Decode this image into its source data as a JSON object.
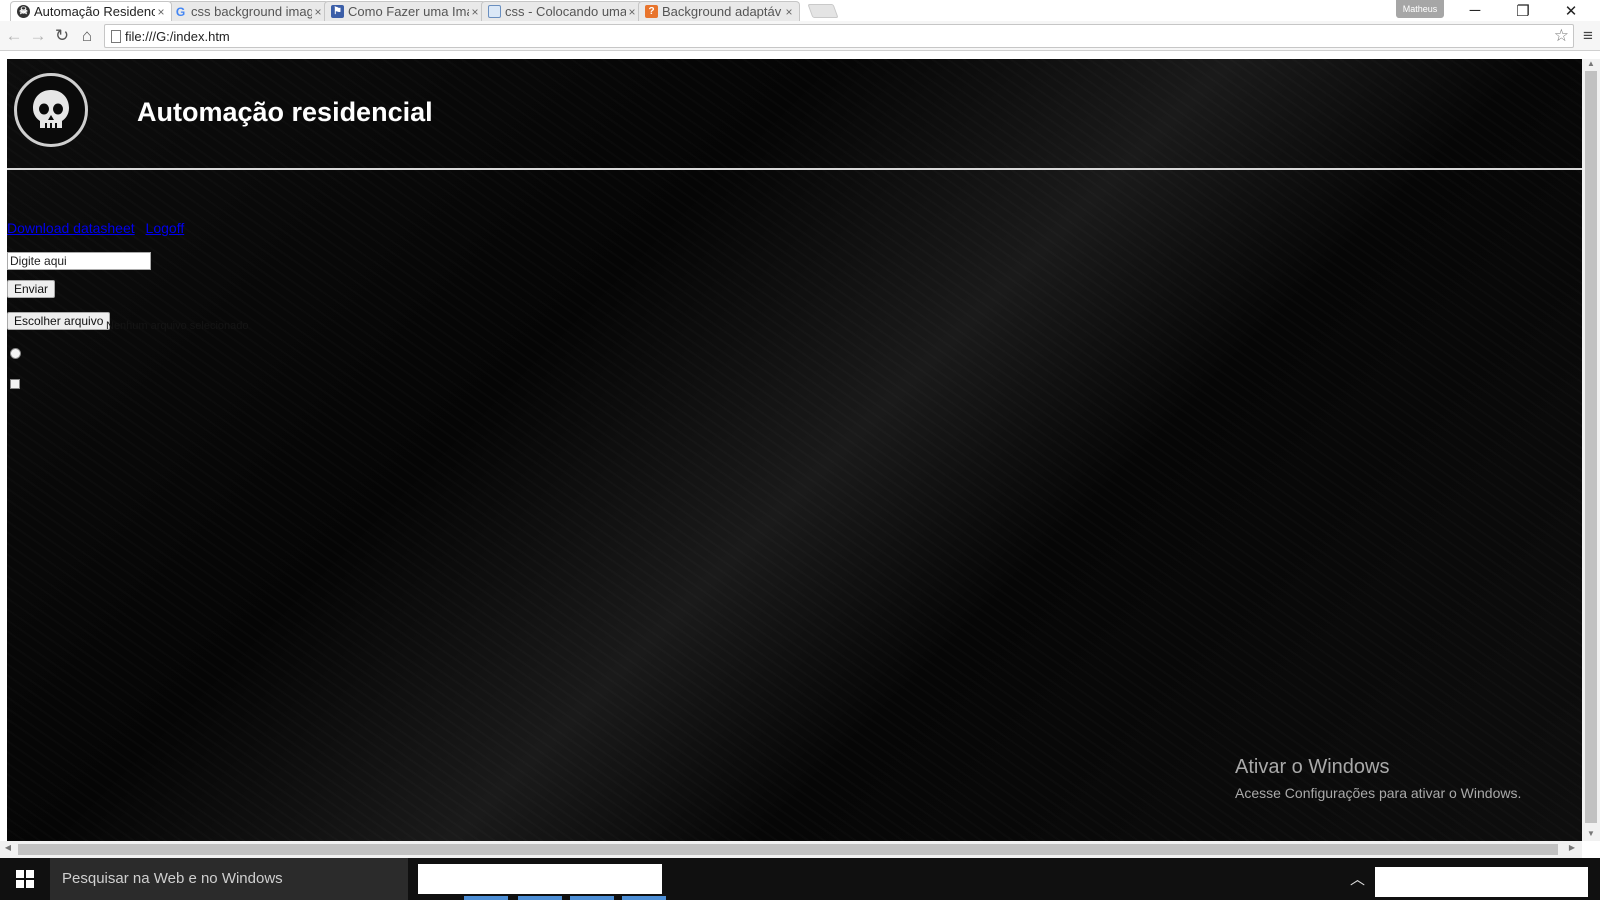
{
  "browser": {
    "tabs": [
      {
        "title": "Automação Residenc",
        "favicon": "skull-favicon",
        "active": true
      },
      {
        "title": "css background imag",
        "favicon": "google-favicon",
        "active": false
      },
      {
        "title": "Como Fazer uma Ima",
        "favicon": "bookmark-favicon",
        "active": false
      },
      {
        "title": "css - Colocando uma",
        "favicon": "page-favicon",
        "active": false
      },
      {
        "title": "Background adaptáv",
        "favicon": "question-favicon",
        "active": false
      }
    ],
    "close_glyph": "×",
    "profile_name": "Matheus",
    "url": "file:///G:/index.htm"
  },
  "page": {
    "title": "Automação residencial",
    "links": [
      "Download datasheet",
      "Logoff"
    ],
    "input_value": "Digite aqui",
    "submit_label": "Enviar",
    "file_button_label": "Escolher arquivo",
    "file_status": "Nenhum arquivo selecionado"
  },
  "watermark": {
    "heading": "Ativar o Windows",
    "subtext": "Acesse Configurações para ativar o Windows."
  },
  "taskbar": {
    "search_placeholder": "Pesquisar na Web e no Windows"
  },
  "colors": {
    "page_background": "#0a0a0a",
    "link": "#0000ee",
    "taskbar": "#101010",
    "taskbar_search": "#2b2b2b"
  }
}
